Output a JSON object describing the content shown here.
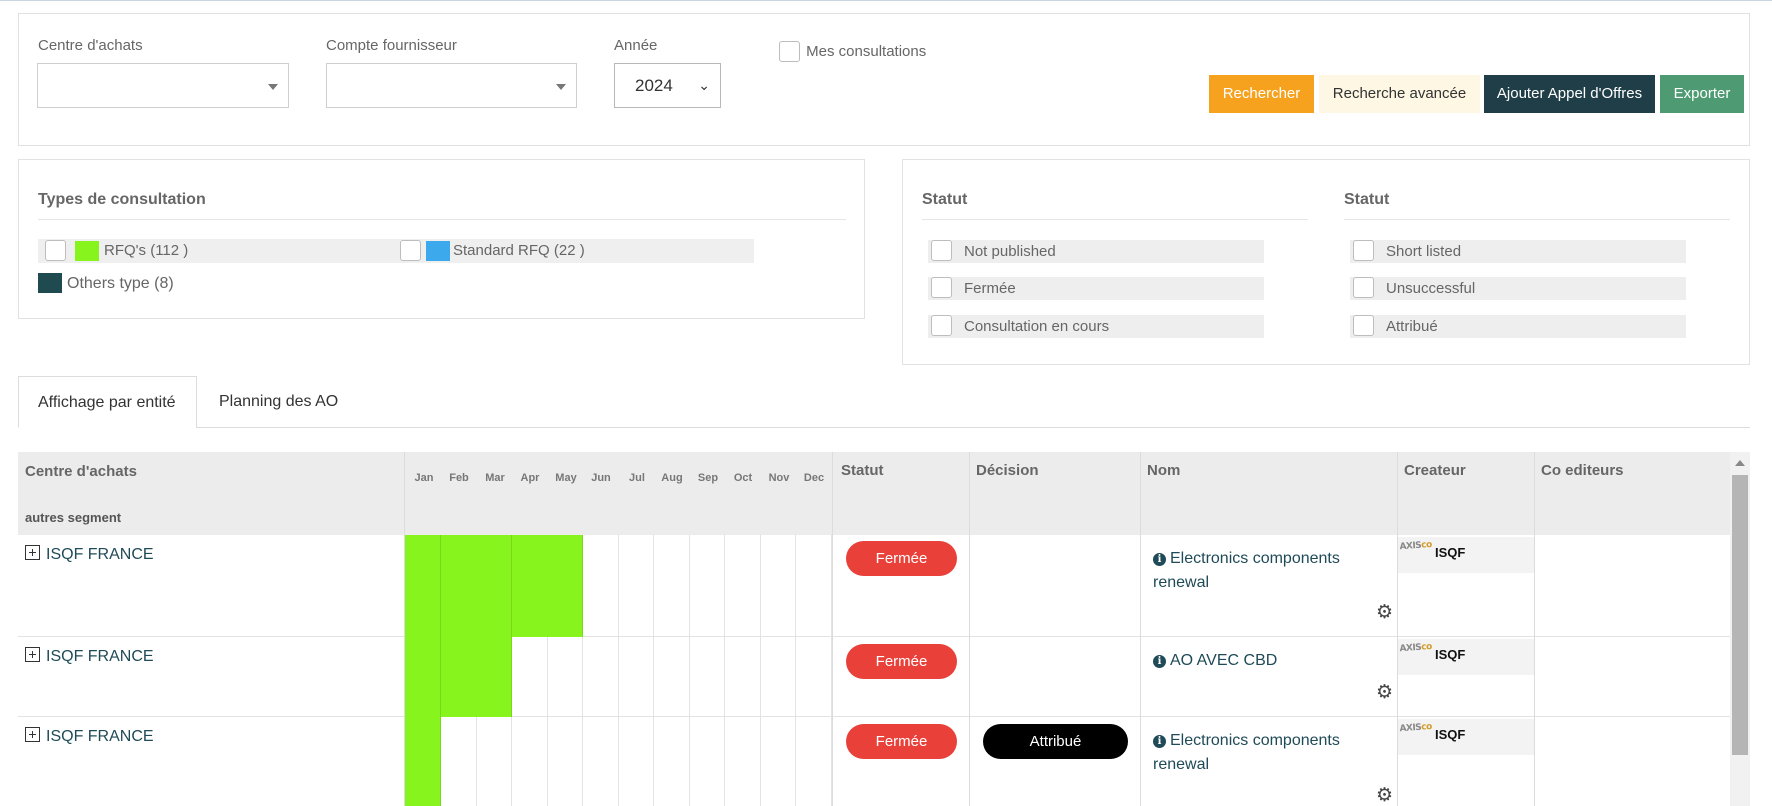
{
  "filters": {
    "centre_label": "Centre d'achats",
    "centre_value": "",
    "compte_label": "Compte fournisseur",
    "compte_value": "",
    "annee_label": "Année",
    "annee_value": "2024",
    "mes_consultations_label": "Mes consultations"
  },
  "buttons": {
    "search": "Rechercher",
    "advanced": "Recherche avancée",
    "add": "Ajouter Appel d'Offres",
    "export": "Exporter"
  },
  "types": {
    "title": "Types de consultation",
    "items": [
      {
        "label": "RFQ's",
        "count": "(112 )",
        "color": "#88f41e"
      },
      {
        "label": "Standard RFQ",
        "count": "(22 )",
        "color": "#3ba9eb"
      },
      {
        "label": "Others type",
        "count": "(8)",
        "color": "#1f4a4f"
      }
    ]
  },
  "statut": {
    "col1_title": "Statut",
    "col1_items": [
      "Not published",
      "Fermée",
      "Consultation en cours"
    ],
    "col2_title": "Statut",
    "col2_items": [
      "Short listed",
      "Unsuccessful",
      "Attribué"
    ]
  },
  "tabs": {
    "entity": "Affichage par entité",
    "planning": "Planning des AO"
  },
  "table": {
    "headers": {
      "centre": "Centre d'achats",
      "statut": "Statut",
      "decision": "Décision",
      "nom": "Nom",
      "createur": "Createur",
      "co_editeurs": "Co editeurs"
    },
    "months": [
      "Jan",
      "Feb",
      "Mar",
      "Apr",
      "May",
      "Jun",
      "Jul",
      "Aug",
      "Sep",
      "Oct",
      "Nov",
      "Dec"
    ],
    "segment": "autres segment",
    "rows": [
      {
        "entity": "ISQF FRANCE",
        "months_active": 5,
        "statut": "Fermée",
        "decision": "",
        "nom": "Electronics components renewal",
        "createur": "ISQF"
      },
      {
        "entity": "ISQF FRANCE",
        "months_active": 3,
        "statut": "Fermée",
        "decision": "",
        "nom": "AO AVEC CBD",
        "createur": "ISQF"
      },
      {
        "entity": "ISQF FRANCE",
        "months_active": 1,
        "statut": "Fermée",
        "decision": "Attribué",
        "nom": "Electronics components renewal",
        "createur": "ISQF"
      }
    ]
  },
  "icons": {
    "info": "info-circle-icon",
    "gear": "gear-icon",
    "expand": "plus-square-icon"
  }
}
